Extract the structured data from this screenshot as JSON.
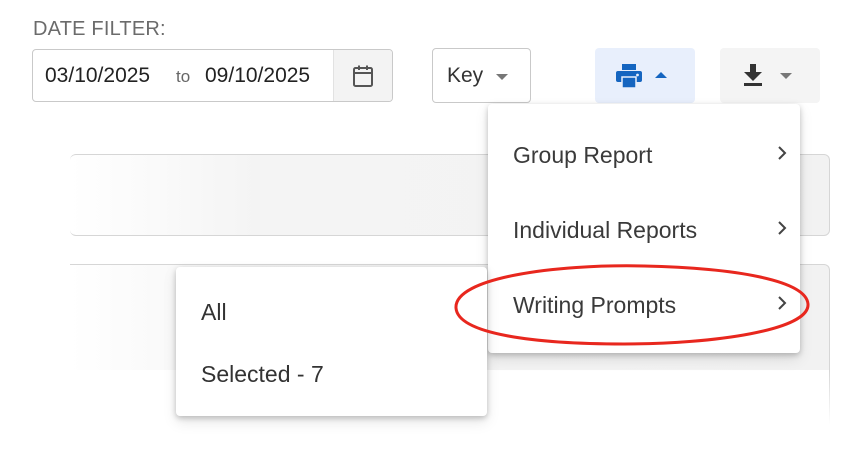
{
  "filters": {
    "date_filter_label": "DATE FILTER:",
    "start_date": "03/10/2025",
    "to_label": "to",
    "end_date": "09/10/2025",
    "calendar_icon": "calendar-icon",
    "key_label": "Key"
  },
  "toolbar": {
    "print_icon": "printer-icon",
    "print_caret_icon": "caret-up-icon",
    "download_icon": "download-icon",
    "download_caret_icon": "caret-down-icon",
    "print_button_color": "#1565c0"
  },
  "print_menu": {
    "items": [
      {
        "label": "Group Report",
        "has_submenu": true
      },
      {
        "label": "Individual Reports",
        "has_submenu": true
      },
      {
        "label": "Writing Prompts",
        "has_submenu": true,
        "highlighted": true
      }
    ]
  },
  "writing_prompts_submenu": {
    "items": [
      {
        "label": "All"
      },
      {
        "label": "Selected - 7"
      }
    ]
  },
  "annotation": {
    "color": "#e8271e"
  }
}
